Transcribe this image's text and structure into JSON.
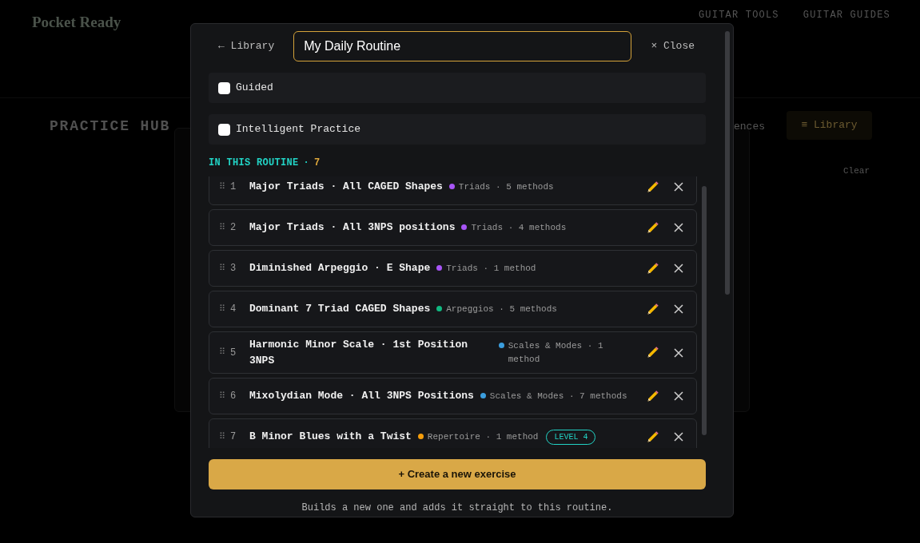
{
  "background": {
    "logo": "Pocket Ready",
    "nav": [
      "GUITAR TOOLS",
      "GUITAR GUIDES"
    ],
    "page_title": "PRACTICE HUB",
    "partial_link": "ences",
    "library_button": "≡ Library",
    "clear_link": "Clear"
  },
  "modal": {
    "back_link": "← Library",
    "title_field": {
      "value": "My Daily Routine"
    },
    "close_button": "× Close",
    "options": [
      {
        "label": "Guided",
        "checked": false
      },
      {
        "label": "Intelligent Practice",
        "checked": false
      }
    ],
    "section": {
      "label": "IN THIS ROUTINE",
      "separator": "·",
      "count": "7"
    },
    "exercises": [
      {
        "handle": "⠿",
        "number": "1",
        "title": "Major Triads · All CAGED Shapes",
        "color": "#a855f7",
        "meta": "Triads · 5 methods"
      },
      {
        "handle": "⠿",
        "number": "2",
        "title": "Major Triads · All 3NPS positions",
        "color": "#a855f7",
        "meta": "Triads · 4 methods"
      },
      {
        "handle": "⠿",
        "number": "3",
        "title": "Diminished Arpeggio · E Shape",
        "color": "#a855f7",
        "meta": "Triads · 1 method"
      },
      {
        "handle": "⠿",
        "number": "4",
        "title": "Dominant 7 Triad CAGED Shapes",
        "color": "#10b981",
        "meta": "Arpeggios · 5 methods"
      },
      {
        "handle": "⠿",
        "number": "5",
        "title": "Harmonic Minor Scale · 1st Position 3NPS",
        "color": "#3b9ede",
        "meta": "Scales & Modes · 1 method"
      },
      {
        "handle": "⠿",
        "number": "6",
        "title": "Mixolydian Mode · All 3NPS Positions",
        "color": "#3b9ede",
        "meta": "Scales & Modes · 7 methods"
      },
      {
        "handle": "⠿",
        "number": "7",
        "title": "B Minor Blues with a Twist",
        "color": "#f59e0b",
        "meta": "Repertoire · 1 method",
        "badge": "LEVEL 4"
      }
    ],
    "create_button": "+ Create a new exercise",
    "hint": "Builds a new one and adds it straight to this routine."
  }
}
